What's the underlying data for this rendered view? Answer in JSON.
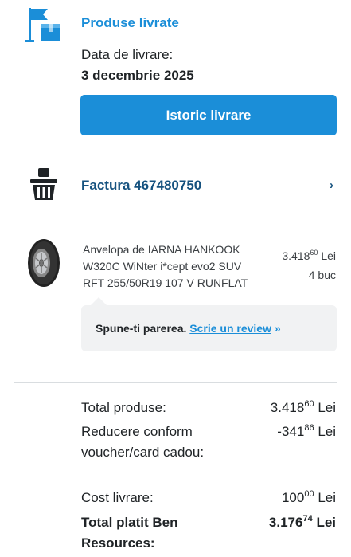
{
  "delivery": {
    "title": "Produse livrate",
    "date_label": "Data de livrare:",
    "date_value": "3 decembrie 2025",
    "history_button": "Istoric livrare",
    "icon": "delivered-flag-box-icon"
  },
  "invoice": {
    "label": "Factura 467480750",
    "chevron": "›",
    "icon": "shopping-basket-icon"
  },
  "product": {
    "name": "Anvelopa de IARNA HANKOOK W320C WiNter i*cept evo2 SUV RFT 255/50R19 107 V RUNFLAT",
    "price_int": "3.418",
    "price_dec": "60",
    "currency": "Lei",
    "quantity": "4 buc",
    "image": "tire-image"
  },
  "review": {
    "prompt": "Spune-ti parerea.",
    "link": "Scrie un review",
    "arrow": "»"
  },
  "totals": {
    "products_label": "Total produse:",
    "products_int": "3.418",
    "products_dec": "60",
    "discount_label": "Reducere conform voucher/card cadou:",
    "discount_int": "-341",
    "discount_dec": "86",
    "shipping_label": "Cost livrare:",
    "shipping_int": "100",
    "shipping_dec": "00",
    "paid_label": "Total platit Ben Resources:",
    "paid_int": "3.176",
    "paid_dec": "74",
    "currency": "Lei"
  },
  "colors": {
    "accent": "#1b8ed8",
    "invoice_text": "#16527f",
    "review_bg": "#f1f2f3",
    "divider": "#d9dde0"
  }
}
